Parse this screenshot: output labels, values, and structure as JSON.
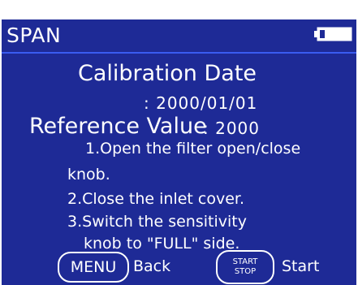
{
  "screen": {
    "title": "SPAN",
    "calibration_date_label": "Calibration Date",
    "calibration_date_value": ": 2000/01/01",
    "reference_value_label": "Reference Value",
    "reference_value": ": 2000",
    "instructions": [
      "1.Open the filter open/close",
      "knob.",
      "2.Close the inlet cover.",
      "3.Switch the sensitivity",
      "knob to \"FULL\" side."
    ]
  },
  "footer": {
    "menu_button": "MENU",
    "back_label": "Back",
    "start_stop_button": {
      "line1": "START",
      "line2": "STOP"
    },
    "start_label": "Start"
  },
  "colors": {
    "background": "#1e2a96",
    "rule": "#3a5cf0",
    "text": "#ffffff"
  },
  "icons": {
    "battery": "battery-icon"
  }
}
